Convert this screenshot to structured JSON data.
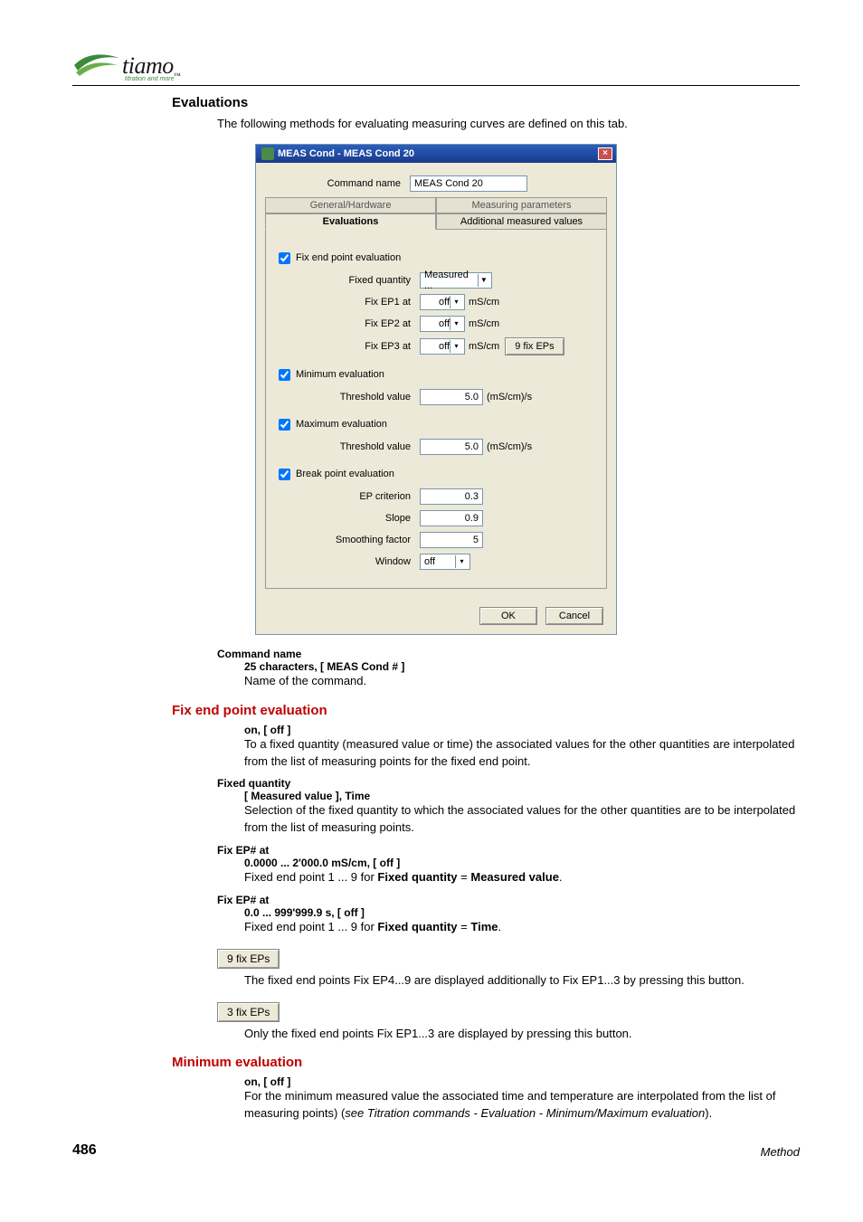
{
  "logo": {
    "wordmark": "tiamo",
    "tagline": "titration and more"
  },
  "section": {
    "title": "Evaluations",
    "intro": "The following methods for evaluating measuring curves are defined on this tab."
  },
  "dialog": {
    "title": "MEAS Cond - MEAS Cond 20",
    "command_label": "Command name",
    "command_value": "MEAS Cond 20",
    "tabs": {
      "general": "General/Hardware",
      "meas_params": "Measuring parameters",
      "evaluations": "Evaluations",
      "additional": "Additional measured values"
    },
    "fix_section": {
      "checkbox": "Fix end point evaluation",
      "fixed_quantity_label": "Fixed quantity",
      "fixed_quantity_value": "Measured ...",
      "ep1_label": "Fix EP1 at",
      "ep1_value": "off",
      "ep1_unit": "mS/cm",
      "ep2_label": "Fix EP2 at",
      "ep2_value": "off",
      "ep2_unit": "mS/cm",
      "ep3_label": "Fix EP3 at",
      "ep3_value": "off",
      "ep3_unit": "mS/cm",
      "more_btn": "9 fix EPs"
    },
    "min_section": {
      "checkbox": "Minimum evaluation",
      "threshold_label": "Threshold value",
      "threshold_value": "5.0",
      "threshold_unit": "(mS/cm)/s"
    },
    "max_section": {
      "checkbox": "Maximum evaluation",
      "threshold_label": "Threshold value",
      "threshold_value": "5.0",
      "threshold_unit": "(mS/cm)/s"
    },
    "break_section": {
      "checkbox": "Break point evaluation",
      "ep_crit_label": "EP criterion",
      "ep_crit_value": "0.3",
      "slope_label": "Slope",
      "slope_value": "0.9",
      "smooth_label": "Smoothing factor",
      "smooth_value": "5",
      "window_label": "Window",
      "window_value": "off"
    },
    "ok": "OK",
    "cancel": "Cancel"
  },
  "defs": {
    "command_name": {
      "term": "Command name",
      "spec": "25 characters, [ MEAS Cond # ]",
      "text": "Name of the command."
    },
    "fix_h": "Fix end point evaluation",
    "fix_on": {
      "spec": "on, [ off ]",
      "text": "To a fixed quantity (measured value or time) the associated values for the other quantities are interpolated from the list of measuring points for the fixed end point."
    },
    "fixed_q": {
      "term": "Fixed quantity",
      "spec": "[ Measured value ], Time",
      "text": "Selection of the fixed quantity to which the associated values for the other quantities are to be interpolated from the list of measuring points."
    },
    "fix_ep_a": {
      "term": "Fix EP# at",
      "spec": "0.0000 ... 2'000.0 mS/cm, [ off ]",
      "text_before": "Fixed end point 1 ... 9 for ",
      "b1": "Fixed quantity",
      "mid": " = ",
      "b2": "Measured value",
      "after": "."
    },
    "fix_ep_b": {
      "term": "Fix EP# at",
      "spec": "0.0 ... 999'999.9 s, [ off ]",
      "text_before": "Fixed end point 1 ... 9 for ",
      "b1": "Fixed quantity",
      "mid": " = ",
      "b2": "Time",
      "after": "."
    },
    "btn9": {
      "label": "9 fix EPs",
      "text": "The fixed end points Fix EP4...9 are displayed additionally to Fix EP1...3 by pressing this button."
    },
    "btn3": {
      "label": "3 fix EPs",
      "text": "Only the fixed end points Fix EP1...3 are displayed by pressing this button."
    },
    "min_h": "Minimum evaluation",
    "min_on": {
      "spec": "on, [ off ]",
      "text_a": "For the minimum measured value the associated time and temperature are interpolated from the list of measuring points) (",
      "see": "see",
      "ref": "  Titration commands - Evaluation - Minimum/Maximum evaluation",
      "text_b": ")."
    }
  },
  "footer": {
    "page": "486",
    "label": "Method"
  }
}
